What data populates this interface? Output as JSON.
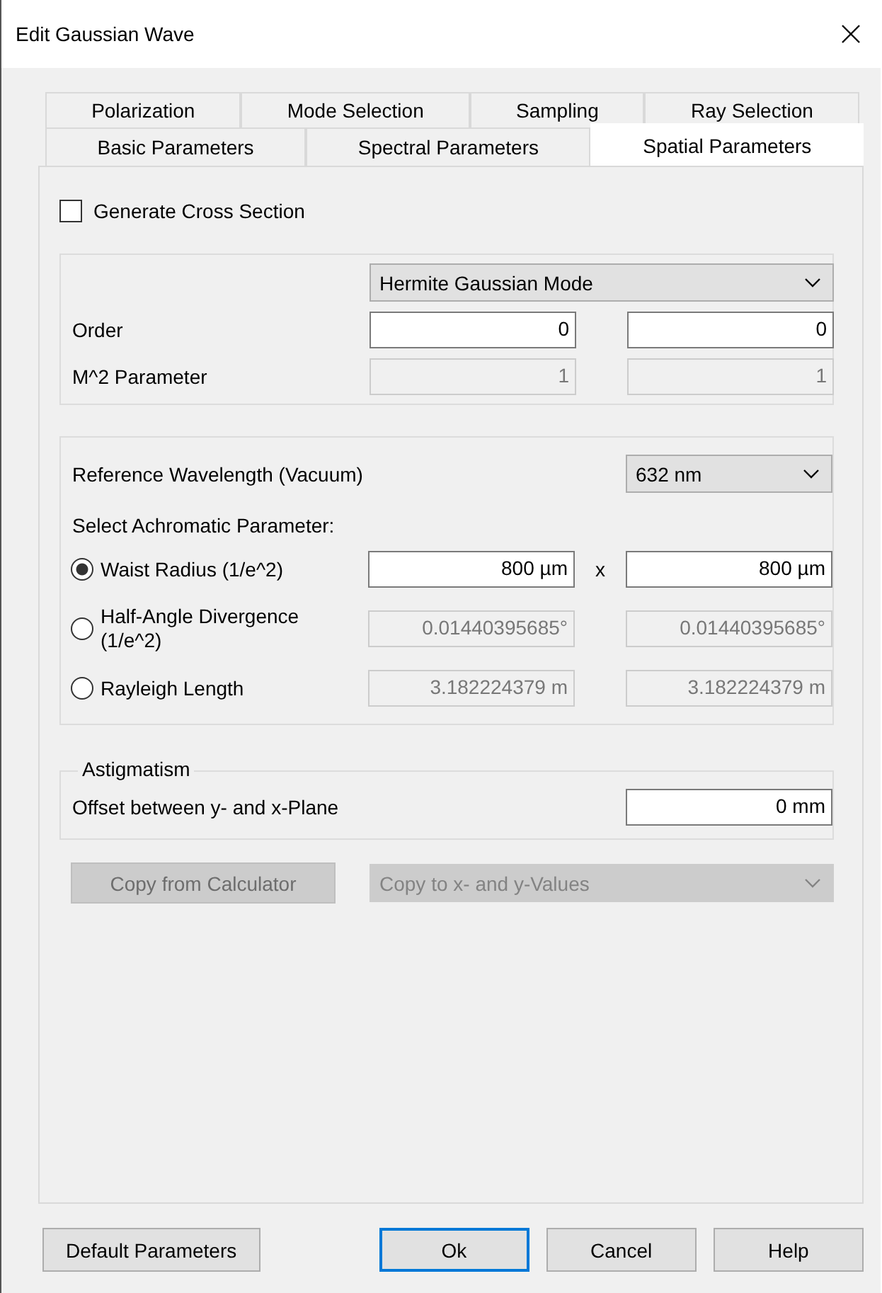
{
  "window": {
    "title": "Edit Gaussian Wave"
  },
  "tab_rows": [
    {
      "tabs": [
        {
          "label": "Polarization",
          "selected": false
        },
        {
          "label": "Mode Selection",
          "selected": false
        },
        {
          "label": "Sampling",
          "selected": false
        },
        {
          "label": "Ray Selection",
          "selected": false
        }
      ]
    },
    {
      "tabs": [
        {
          "label": "Basic Parameters",
          "selected": false
        },
        {
          "label": "Spectral Parameters",
          "selected": false
        },
        {
          "label": "Spatial Parameters",
          "selected": true
        }
      ]
    }
  ],
  "generate_cross_section": {
    "label": "Generate Cross Section",
    "checked": false
  },
  "mode": {
    "dropdown": "Hermite Gaussian Mode",
    "rows": [
      {
        "label": "Order",
        "values": [
          "0",
          "0"
        ],
        "disabled": false
      },
      {
        "label": "M^2 Parameter",
        "values": [
          "1",
          "1"
        ],
        "disabled": true
      }
    ]
  },
  "wavelength": {
    "label": "Reference Wavelength (Vacuum)",
    "value": "632 nm"
  },
  "achromatic": {
    "label": "Select Achromatic Parameter:",
    "options": [
      {
        "label": "Waist Radius (1/e^2)",
        "selected": true,
        "disabled": false,
        "values": [
          "800 µm",
          "800 µm"
        ],
        "separator": "x"
      },
      {
        "label": "Half-Angle Divergence (1/e^2)",
        "selected": false,
        "disabled": true,
        "values": [
          "0.01440395685°",
          "0.01440395685°"
        ]
      },
      {
        "label": "Rayleigh Length",
        "selected": false,
        "disabled": true,
        "values": [
          "3.182224379 m",
          "3.182224379 m"
        ]
      }
    ]
  },
  "astigmatism": {
    "title": "Astigmatism",
    "label": "Offset between y- and x-Plane",
    "value": "0 mm"
  },
  "copy_button": {
    "label": "Copy from Calculator",
    "disabled": true
  },
  "copy_dropdown": {
    "value": "Copy to x- and y-Values",
    "disabled": true
  },
  "buttons": [
    {
      "label": "Default Parameters",
      "default": false
    },
    {
      "label": "Ok",
      "default": true
    },
    {
      "label": "Cancel",
      "default": false
    },
    {
      "label": "Help",
      "default": false
    }
  ]
}
